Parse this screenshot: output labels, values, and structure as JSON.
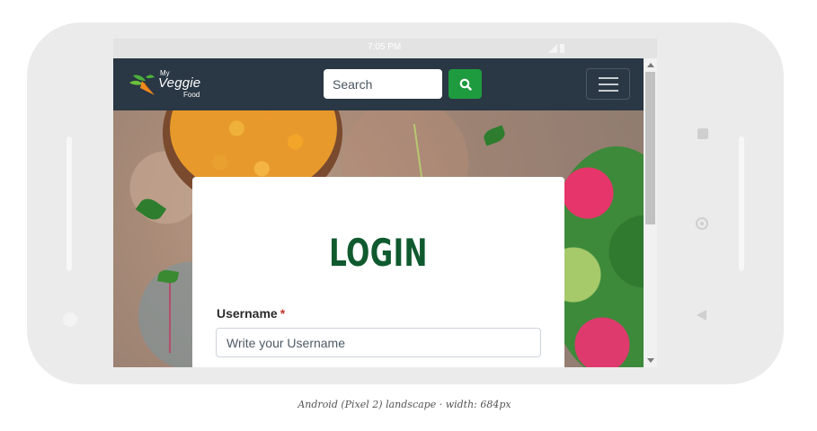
{
  "device": {
    "status_time": "7:05 PM"
  },
  "brand": {
    "logo_line1": "My",
    "logo_line2": "Veggie",
    "logo_line3": "Food"
  },
  "navbar": {
    "search_placeholder": "Search",
    "search_icon": "search-icon",
    "menu_icon": "hamburger-menu-icon",
    "background_color": "#2a3744",
    "search_button_color": "#1f9b3f"
  },
  "login": {
    "title": "LOGIN",
    "username_label": "Username",
    "required_marker": "*",
    "username_placeholder": "Write your Username",
    "title_color": "#0f5a2f"
  },
  "caption": "Android (Pixel 2) landscape · width: 684px"
}
